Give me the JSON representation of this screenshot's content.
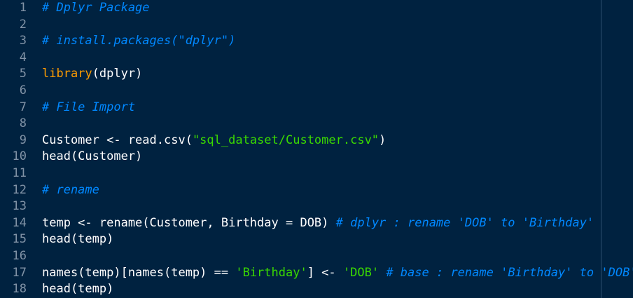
{
  "editor": {
    "language": "R",
    "colors": {
      "background": "#002240",
      "comment": "#0088ff",
      "string": "#3ad900",
      "function_highlight": "#ff9d00",
      "text": "#ffffff",
      "gutter": "#8193a6"
    },
    "lines": [
      {
        "num": "1",
        "parts": [
          {
            "t": "comment",
            "text": "# Dplyr Package"
          }
        ]
      },
      {
        "num": "2",
        "parts": []
      },
      {
        "num": "3",
        "parts": [
          {
            "t": "comment",
            "text": "# install.packages(\"dplyr\")"
          }
        ]
      },
      {
        "num": "4",
        "parts": []
      },
      {
        "num": "5",
        "parts": [
          {
            "t": "keyword-fn",
            "text": "library"
          },
          {
            "t": "plain",
            "text": "(dplyr)"
          }
        ]
      },
      {
        "num": "6",
        "parts": []
      },
      {
        "num": "7",
        "parts": [
          {
            "t": "comment",
            "text": "# File Import"
          }
        ]
      },
      {
        "num": "8",
        "parts": []
      },
      {
        "num": "9",
        "parts": [
          {
            "t": "plain",
            "text": "Customer <- read.csv("
          },
          {
            "t": "string",
            "text": "\"sql_dataset/Customer.csv\""
          },
          {
            "t": "plain",
            "text": ")"
          }
        ]
      },
      {
        "num": "10",
        "parts": [
          {
            "t": "plain",
            "text": "head(Customer)"
          }
        ]
      },
      {
        "num": "11",
        "parts": []
      },
      {
        "num": "12",
        "parts": [
          {
            "t": "comment",
            "text": "# rename"
          }
        ]
      },
      {
        "num": "13",
        "parts": []
      },
      {
        "num": "14",
        "parts": [
          {
            "t": "plain",
            "text": "temp <- rename(Customer, Birthday = DOB) "
          },
          {
            "t": "comment",
            "text": "# dplyr : rename 'DOB' to 'Birthday'"
          }
        ]
      },
      {
        "num": "15",
        "parts": [
          {
            "t": "plain",
            "text": "head(temp)"
          }
        ]
      },
      {
        "num": "16",
        "parts": []
      },
      {
        "num": "17",
        "parts": [
          {
            "t": "plain",
            "text": "names(temp)[names(temp) == "
          },
          {
            "t": "string",
            "text": "'Birthday'"
          },
          {
            "t": "plain",
            "text": "] <- "
          },
          {
            "t": "string",
            "text": "'DOB'"
          },
          {
            "t": "plain",
            "text": " "
          },
          {
            "t": "comment",
            "text": "# base : rename 'Birthday' to 'DOB'"
          }
        ]
      },
      {
        "num": "18",
        "parts": [
          {
            "t": "plain",
            "text": "head(temp)"
          }
        ]
      }
    ]
  }
}
